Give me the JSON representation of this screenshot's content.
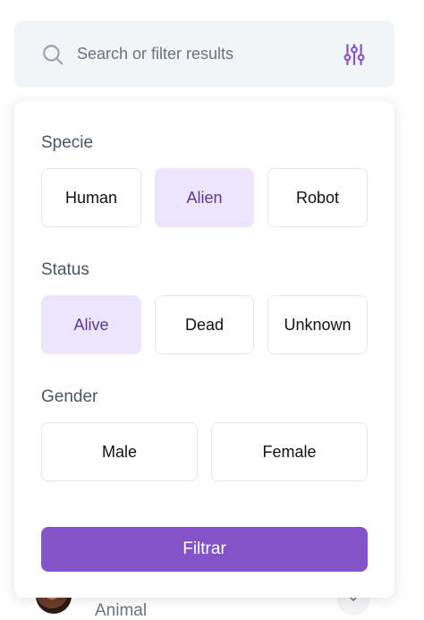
{
  "search": {
    "placeholder": "Search or filter results"
  },
  "filters": {
    "specie": {
      "title": "Specie",
      "options": [
        "Human",
        "Alien",
        "Robot"
      ],
      "selected": "Alien"
    },
    "status": {
      "title": "Status",
      "options": [
        "Alive",
        "Dead",
        "Unknown"
      ],
      "selected": "Alive"
    },
    "gender": {
      "title": "Gender",
      "options": [
        "Male",
        "Female"
      ],
      "selected": null
    }
  },
  "apply_button": "Filtrar",
  "background_item": {
    "subtitle": "Animal"
  },
  "colors": {
    "accent": "#8553c8",
    "selected_bg": "#ede5fb",
    "selected_text": "#5b3a91",
    "search_bg": "#f3f4f6"
  },
  "icons": {
    "search": "search-icon",
    "filter": "sliders-icon",
    "chevron": "chevron-down-icon"
  }
}
